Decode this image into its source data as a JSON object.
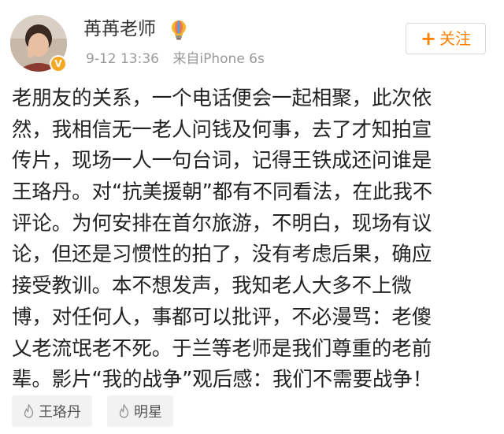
{
  "post": {
    "author_name": "苒苒老师",
    "author_badge_icon": "lightbulb-icon",
    "verified_icon": "v-badge-icon",
    "verified_label": "V",
    "time": "9-12 13:36",
    "source": "来自iPhone 6s",
    "follow_button": {
      "icon": "plus-icon",
      "plus": "+",
      "label": "关注"
    },
    "text_lines": [
      "老朋友的关系，一个电话便会一起相聚，此次依",
      "然，我相信无一老人问钱及何事，去了才知拍宣",
      "传片，现场一人一句台词，记得王铁成还问谁是",
      "王珞丹。对“抗美援朝”都有不同看法，在此我不",
      "评论。为何安排在首尔旅游，不明白，现场有议",
      "论，但还是习惯性的拍了，没有考虑后果，确应",
      "接受教训。本不想发声，我知老人大多不上微",
      "博，对任何人，事都可以批评，不必漫骂：老傻",
      "乂老流氓老不死。于兰等老师是我们尊重的老前",
      "辈。影片“我的战争”观后感：我们不需要战争！"
    ],
    "tags": [
      {
        "icon": "flame-icon",
        "label": "王珞丹"
      },
      {
        "icon": "flame-icon",
        "label": "明星"
      }
    ]
  },
  "colors": {
    "accent": "#ff8200",
    "name": "#333333",
    "meta": "#999999",
    "text": "#222222",
    "tag_bg": "#f2f2f2",
    "badge": "#f5a623"
  }
}
